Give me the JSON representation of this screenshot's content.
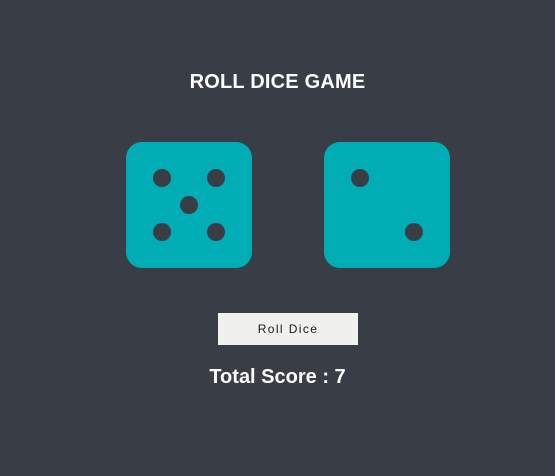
{
  "game": {
    "title": "ROLL DICE GAME"
  },
  "dice": [
    {
      "value": 5,
      "pip_color": "#393e46",
      "face_color": "#00adb5"
    },
    {
      "value": 2,
      "pip_color": "#393e46",
      "face_color": "#00adb5"
    }
  ],
  "controls": {
    "roll_label": "Roll Dice"
  },
  "score": {
    "label": "Total Score : ",
    "value": "7"
  },
  "colors": {
    "background": "#393e46",
    "accent": "#00adb5",
    "button_bg": "#f0f0ec",
    "text": "#ffffff"
  }
}
